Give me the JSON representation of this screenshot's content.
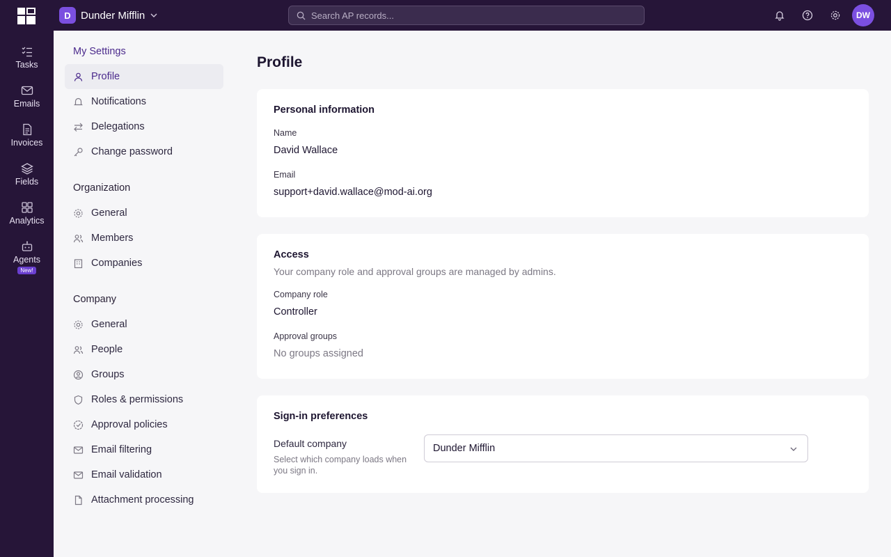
{
  "workspace": {
    "initial": "D",
    "name": "Dunder Mifflin"
  },
  "search": {
    "placeholder": "Search AP records..."
  },
  "user": {
    "initials": "DW"
  },
  "rail": [
    {
      "label": "Tasks",
      "icon": "tasks-icon"
    },
    {
      "label": "Emails",
      "icon": "mail-icon"
    },
    {
      "label": "Invoices",
      "icon": "document-icon"
    },
    {
      "label": "Fields",
      "icon": "layers-icon"
    },
    {
      "label": "Analytics",
      "icon": "grid-icon"
    },
    {
      "label": "Agents",
      "icon": "robot-icon",
      "badge": "New!"
    }
  ],
  "nav": {
    "my_settings": {
      "title": "My Settings",
      "items": [
        {
          "label": "Profile",
          "icon": "user-icon"
        },
        {
          "label": "Notifications",
          "icon": "bell-icon"
        },
        {
          "label": "Delegations",
          "icon": "arrows-swap-icon"
        },
        {
          "label": "Change password",
          "icon": "key-icon"
        }
      ]
    },
    "organization": {
      "title": "Organization",
      "items": [
        {
          "label": "General",
          "icon": "gear-icon"
        },
        {
          "label": "Members",
          "icon": "users-icon"
        },
        {
          "label": "Companies",
          "icon": "building-icon"
        }
      ]
    },
    "company": {
      "title": "Company",
      "items": [
        {
          "label": "General",
          "icon": "gear-icon"
        },
        {
          "label": "People",
          "icon": "users-icon"
        },
        {
          "label": "Groups",
          "icon": "user-circle-icon"
        },
        {
          "label": "Roles & permissions",
          "icon": "shield-icon"
        },
        {
          "label": "Approval policies",
          "icon": "check-badge-icon"
        },
        {
          "label": "Email filtering",
          "icon": "mail-icon"
        },
        {
          "label": "Email validation",
          "icon": "mail-icon"
        },
        {
          "label": "Attachment processing",
          "icon": "file-icon"
        }
      ]
    }
  },
  "page": {
    "title": "Profile",
    "personal": {
      "title": "Personal information",
      "name_label": "Name",
      "name_value": "David Wallace",
      "email_label": "Email",
      "email_value": "support+david.wallace@mod-ai.org"
    },
    "access": {
      "title": "Access",
      "description": "Your company role and approval groups are managed by admins.",
      "role_label": "Company role",
      "role_value": "Controller",
      "groups_label": "Approval groups",
      "groups_value": "No groups assigned"
    },
    "signin": {
      "title": "Sign-in preferences",
      "default_label": "Default company",
      "default_help": "Select which company loads when you sign in.",
      "default_value": "Dunder Mifflin"
    }
  },
  "colors": {
    "topbar": "#261538",
    "accent": "#7b4fe0",
    "active_text": "#4b2a8c"
  }
}
